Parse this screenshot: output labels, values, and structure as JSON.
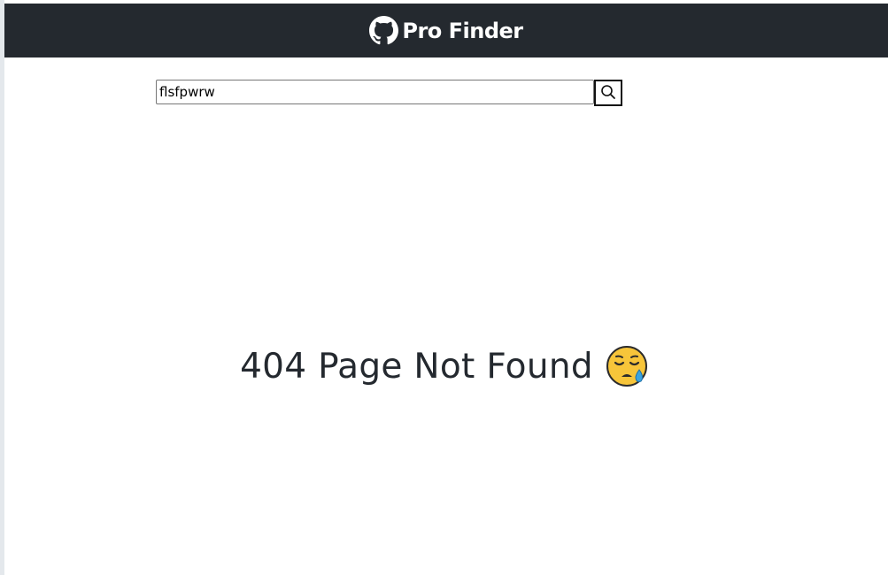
{
  "header": {
    "brand_name": "Pro Finder",
    "brand_icon": "github-icon",
    "background_color": "#24292f"
  },
  "search": {
    "value": "flsfpwrw",
    "button_icon": "search-icon"
  },
  "message": {
    "text": "404 Page Not Found",
    "emoji_icon": "sad-crying-face-icon"
  }
}
